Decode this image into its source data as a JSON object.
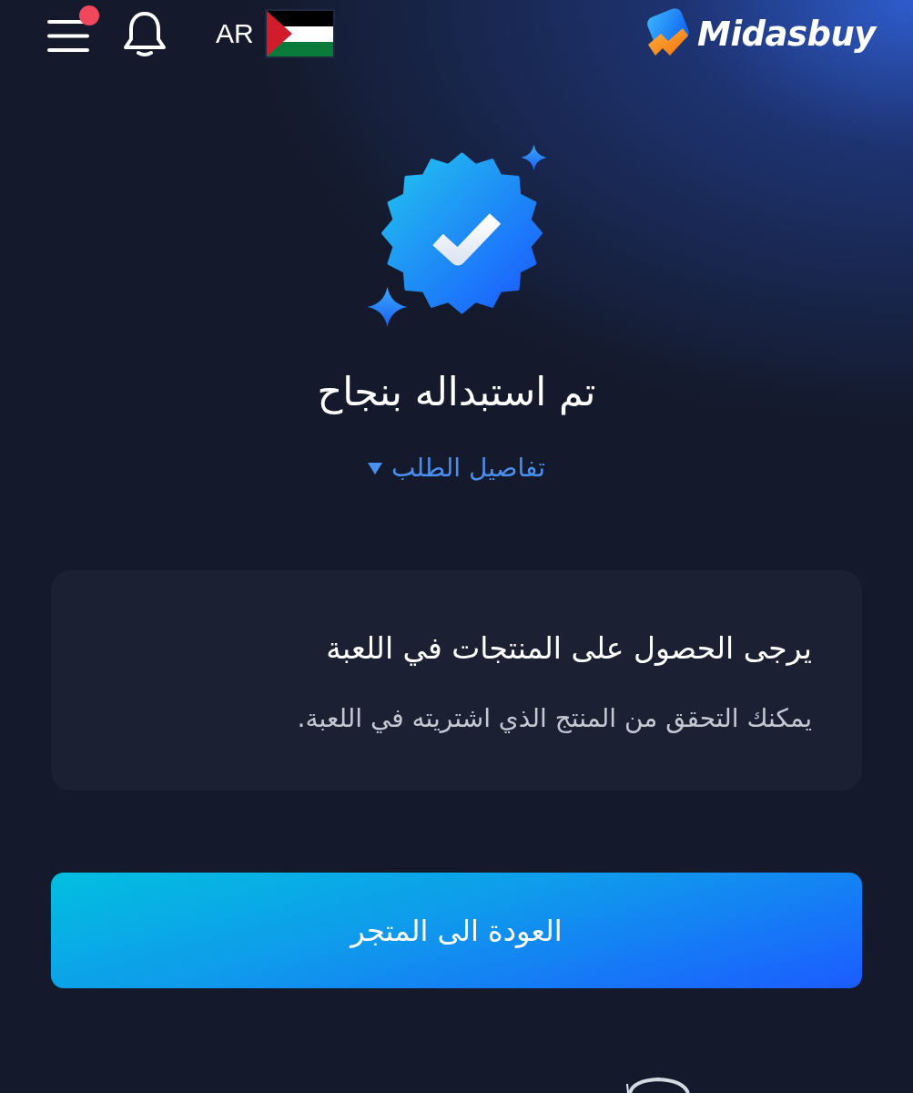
{
  "header": {
    "menu": {
      "notification_dot": true
    },
    "language": "AR",
    "logo_text": "Midasbuy"
  },
  "result": {
    "title": "تم استبداله بنجاح",
    "details_link": {
      "label": "تفاصيل الطلب",
      "expanded": false
    }
  },
  "notice_card": {
    "heading": "يرجى الحصول على المنتجات في اللعبة",
    "body": "يمكنك التحقق من المنتج الذي اشتريته في اللعبة."
  },
  "back_button": {
    "label": "العودة الى المتجر"
  }
}
